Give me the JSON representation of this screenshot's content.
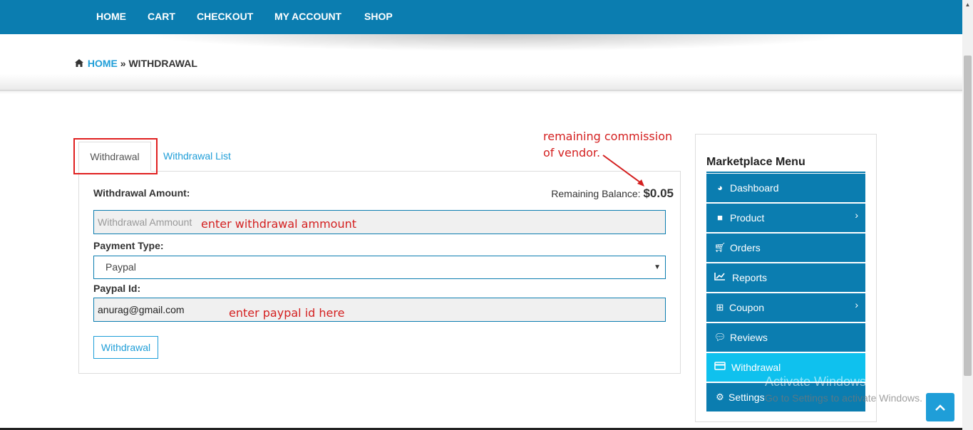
{
  "nav": {
    "items": [
      "HOME",
      "CART",
      "CHECKOUT",
      "MY ACCOUNT",
      "SHOP"
    ]
  },
  "breadcrumb": {
    "home": "HOME",
    "separator": "»",
    "current": "WITHDRAWAL"
  },
  "tabs": {
    "active": "Withdrawal",
    "other": "Withdrawal List"
  },
  "form": {
    "amount_label": "Withdrawal Amount:",
    "balance_label": "Remaining Balance:",
    "balance_value": "$0.05",
    "amount_placeholder": "Withdrawal Ammount",
    "payment_label": "Payment Type:",
    "payment_value": "Paypal",
    "paypal_label": "Paypal Id:",
    "paypal_value": "anurag@gmail.com",
    "submit_label": "Withdrawal"
  },
  "annotations": {
    "commission_line1": "remaining commission",
    "commission_line2": "of vendor.",
    "amount_hint": "enter withdrawal ammount",
    "paypal_hint": "enter paypal id here"
  },
  "sidebar": {
    "title": "Marketplace Menu",
    "items": [
      {
        "label": "Dashboard",
        "icon": "dashboard-icon"
      },
      {
        "label": "Product",
        "icon": "briefcase-icon",
        "submenu": true
      },
      {
        "label": "Orders",
        "icon": "cart-icon"
      },
      {
        "label": "Reports",
        "icon": "chart-icon"
      },
      {
        "label": "Coupon",
        "icon": "gift-icon",
        "submenu": true
      },
      {
        "label": "Reviews",
        "icon": "comments-icon"
      },
      {
        "label": "Withdrawal",
        "icon": "credit-card-icon",
        "active": true
      },
      {
        "label": "Settings",
        "icon": "gear-icon"
      }
    ]
  },
  "watermark": {
    "line1": "Activate Windows",
    "line2": "Go to Settings to activate Windows."
  },
  "colors": {
    "primary": "#0b7db0",
    "active": "#0fc1ee",
    "link": "#1f9ed8",
    "annotation": "#d42020"
  }
}
